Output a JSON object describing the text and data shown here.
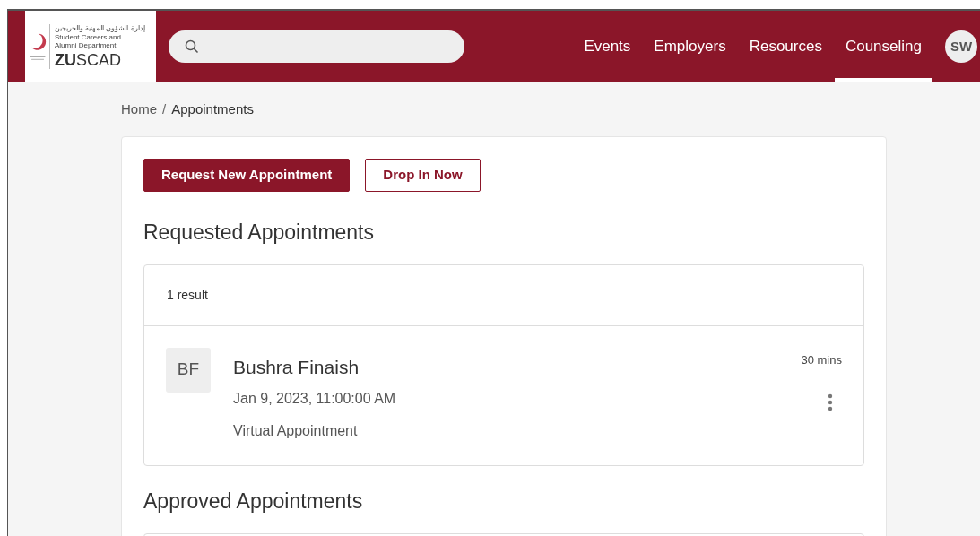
{
  "logo": {
    "arabic": "إدارة الشؤون المهنية والخريجين",
    "line_1": "Student Careers and",
    "line_2": "Alumni Department",
    "wordmark": "**ZU**SCAD"
  },
  "nav": [
    {
      "label": "Events",
      "selected": false
    },
    {
      "label": "Employers",
      "selected": false
    },
    {
      "label": "Resources",
      "selected": false
    },
    {
      "label": "Counseling",
      "selected": true
    }
  ],
  "user_avatar": "SW",
  "breadcrumb": [
    "Home",
    "Appointments"
  ],
  "breadcrumb_separator": "/",
  "actions": [
    {
      "label": "Request New Appointment",
      "kind": "primary"
    },
    {
      "label": "Drop In Now",
      "kind": "outline"
    }
  ],
  "requested": {
    "title": "Requested Appointments",
    "count": "1 result",
    "items": [
      {
        "initials": "BF",
        "name": "Bushra Finaish",
        "datetime": "Jan 9, 2023, 11:00:00 AM",
        "type": "Virtual Appointment",
        "duration": "30 mins"
      }
    ]
  },
  "approved": {
    "title": "Approved Appointments"
  }
}
